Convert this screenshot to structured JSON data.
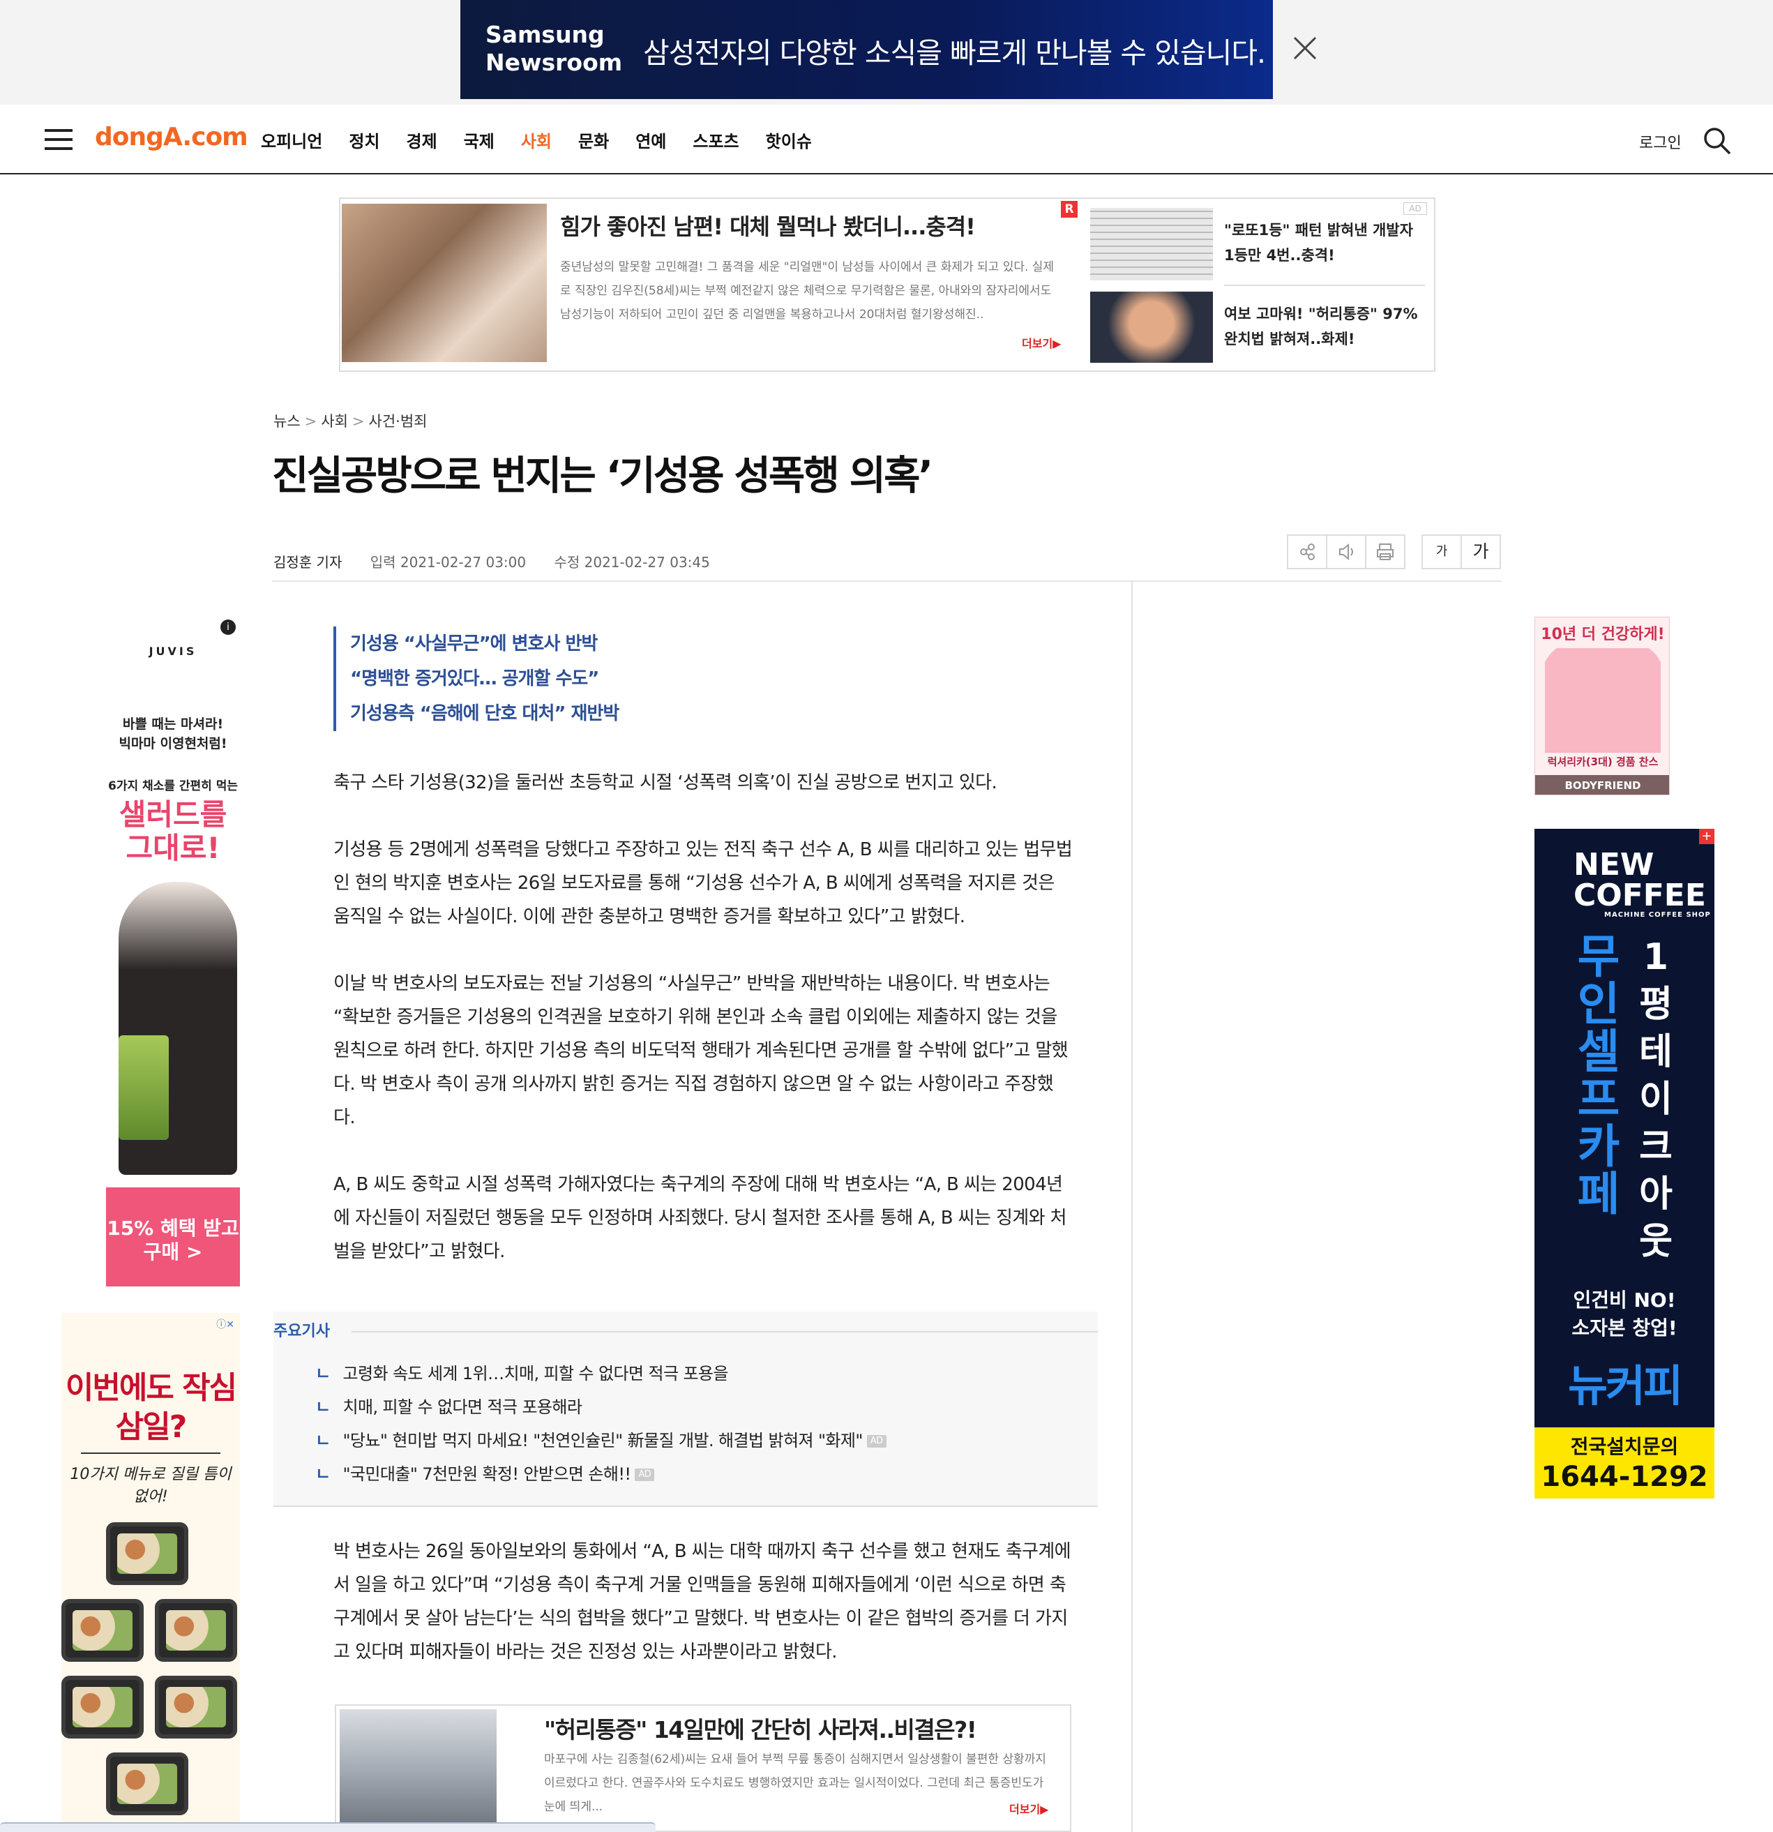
{
  "top_banner": {
    "brand_line1": "Samsung",
    "brand_line2": "Newsroom",
    "message": "삼성전자의 다양한 소식을 빠르게 만나볼 수 있습니다."
  },
  "nav": {
    "logo": "dongA.com",
    "menu": [
      "오피니언",
      "정치",
      "경제",
      "국제",
      "사회",
      "문화",
      "연예",
      "스포츠",
      "핫이슈"
    ],
    "active_menu": "사회",
    "login": "로그인"
  },
  "top_ad": {
    "title": "힘가 좋아진 남편! 대체 뭘먹나 봤더니...충격!",
    "body": "중년남성의 말못할 고민해결! 그 품격을 세운 \"리얼맨\"이 남성들 사이에서 큰 화제가 되고 있다. 실제로 직장인 김우진(58세)씨는 부쩍 예전같지 않은 체력으로 무기력함은 물론, 아내와의 잠자리에서도 남성기능이 저하되어 고민이 깊던 중 리얼맨을 복용하고나서 20대처럼 혈기왕성해진..",
    "more": "더보기▶",
    "r_badge": "R",
    "ad_badge": "AD",
    "side1": "\"로또1등\" 패턴 밝혀낸 개발자 1등만 4번..충격!",
    "side2": "여보 고마워! \"허리통증\" 97% 완치법 밝혀져..화제!"
  },
  "breadcrumb": [
    "뉴스",
    "사회",
    "사건·범죄"
  ],
  "breadcrumb_sep": ">",
  "article": {
    "title": "진실공방으로 번지는 ‘기성용 성폭행 의혹’",
    "author": "김정훈 기자",
    "input_date": "입력 2021-02-27 03:00",
    "modified_date": "수정 2021-02-27 03:45",
    "summary": [
      "기성용 “사실무근”에 변호사 반박",
      "“명백한 증거있다… 공개할 수도”",
      "기성용측 “음해에 단호 대처” 재반박"
    ],
    "paragraphs": [
      "축구 스타 기성용(32)을 둘러싼 초등학교 시절 ‘성폭력 의혹’이 진실 공방으로 번지고 있다.",
      "기성용 등 2명에게 성폭력을 당했다고 주장하고 있는 전직 축구 선수 A, B 씨를 대리하고 있는 법무법인 현의 박지훈 변호사는 26일 보도자료를 통해 “기성용 선수가 A, B 씨에게 성폭력을 저지른 것은 움직일 수 없는 사실이다. 이에 관한 충분하고 명백한 증거를 확보하고 있다”고 밝혔다.",
      "이날 박 변호사의 보도자료는 전날 기성용의 “사실무근” 반박을 재반박하는 내용이다. 박 변호사는 “확보한 증거들은 기성용의 인격권을 보호하기 위해 본인과 소속 클럽 이외에는 제출하지 않는 것을 원칙으로 하려 한다. 하지만 기성용 측의 비도덕적 행태가 계속된다면 공개를 할 수밖에 없다”고 말했다. 박 변호사 측이 공개 의사까지 밝힌 증거는 직접 경험하지 않으면 알 수 없는 사항이라고 주장했다.",
      "A, B 씨도 중학교 시절 성폭력 가해자였다는 축구계의 주장에 대해 박 변호사는 “A, B 씨는 2004년에 자신들이 저질렀던 행동을 모두 인정하며 사죄했다. 당시 철저한 조사를 통해 A, B 씨는 징계와 처벌을 받았다”고 밝혔다.",
      "박 변호사는 26일 동아일보와의 통화에서 “A, B 씨는 대학 때까지 축구 선수를 했고 현재도 축구계에서 일을 하고 있다”며 “기성용 측이 축구계 거물 인맥들을 동원해 피해자들에게 ‘이런 식으로 하면 축구계에서 못 살아 남는다’는 식의 협박을 했다”고 말했다. 박 변호사는 이 같은 협박의 증거를 더 가지고 있다며 피해자들이 바라는 것은 진정성 있는 사과뿐이라고 밝혔다."
    ]
  },
  "related": {
    "label": "주요기사",
    "items": [
      {
        "text": "고령화 속도 세계 1위…치매, 피할 수 없다면 적극 포용을",
        "ad": ""
      },
      {
        "text": "치매, 피할 수 없다면 적극 포용해라",
        "ad": ""
      },
      {
        "text": "\"당뇨\" 현미밥 먹지 마세요! \"천연인슐린\" 新물질 개발. 해결법 밝혀져 \"화제\"",
        "ad": "AD"
      },
      {
        "text": "\"국민대출\" 7천만원 확정! 안받으면 손해!!",
        "ad": "AD"
      }
    ]
  },
  "tools": {
    "font_small": "가",
    "font_large": "가"
  },
  "inline_ad": {
    "title": "\"허리통증\" 14일만에 간단히 사라져..비결은?!",
    "body": "마포구에 사는 김종철(62세)씨는 요새 들어 부쩍 무릎 통증이 심해지면서 일상생활이 불편한 상황까지 이르렀다고 한다. 연골주사와 도수치료도 병행하였지만 효과는 일시적이었다. 그런데 최근 통증빈도가 눈에 띄게...",
    "more": "더보기▶"
  },
  "left_ad_1": {
    "logo": "JUVIS",
    "line1": "바쁠 때는 마셔라!",
    "line2": "빅마마 이영현처럼!",
    "line3": "6가지 채소를 간편히 먹는",
    "headline": "샐러드를 그대로!",
    "cta": "15% 혜택 받고 구매 >",
    "info": "i"
  },
  "left_ad_2": {
    "headline": "이번에도 작심삼일?",
    "sub": "10가지 메뉴로 질릴 틈이 없어!",
    "ad_icon": "ⓘ✕"
  },
  "right_ad_1": {
    "headline": "10년 더 건강하게!",
    "line": "럭셔리카(3대) 경품 찬스",
    "brand": "BODYFRIEND"
  },
  "right_ad_2": {
    "logo": "NEW COFFEE",
    "logo_sub": "MACHINE COFFEE SHOP",
    "col1": "무인셀프카페",
    "col2": "1평테이크아웃",
    "line1": "인건비 NO!",
    "line2": "소자본 창업!",
    "brand": "뉴커피",
    "cta_label": "전국설치문의",
    "cta_phone": "1644-1292",
    "plus": "+"
  },
  "colors": {
    "brand_orange": "#f26722",
    "summary_blue": "#2c4f95",
    "ad_red": "#d22"
  }
}
